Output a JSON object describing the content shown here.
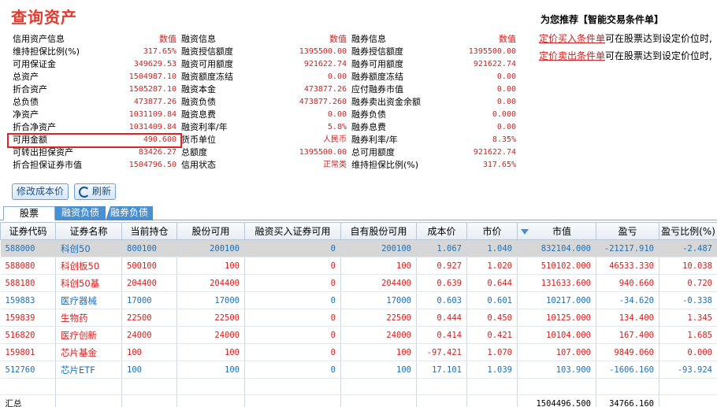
{
  "title": "查询资产",
  "info": {
    "rows": [
      [
        {
          "label": "信用资产信息",
          "value": "数值",
          "hdr": true
        },
        {
          "label": "融资信息",
          "value": "数值",
          "hdr": true
        },
        {
          "label": "融券信息",
          "value": "数值",
          "hdr": true
        }
      ],
      [
        {
          "label": "维持担保比例(%)",
          "value": "317.65%"
        },
        {
          "label": "融资授信额度",
          "value": "1395500.00"
        },
        {
          "label": "融券授信额度",
          "value": "1395500.00"
        }
      ],
      [
        {
          "label": "可用保证金",
          "value": "349629.53"
        },
        {
          "label": "融资可用额度",
          "value": "921622.74"
        },
        {
          "label": "融券可用额度",
          "value": "921622.74"
        }
      ],
      [
        {
          "label": "总资产",
          "value": "1504987.10"
        },
        {
          "label": "融资额度冻结",
          "value": "0.00"
        },
        {
          "label": "融券额度冻结",
          "value": "0.00"
        }
      ],
      [
        {
          "label": "折合资产",
          "value": "1505287.10"
        },
        {
          "label": "融资本金",
          "value": "473877.26"
        },
        {
          "label": "应付融券市值",
          "value": "0.00"
        }
      ],
      [
        {
          "label": "总负债",
          "value": "473877.26"
        },
        {
          "label": "融资负债",
          "value": "473877.260"
        },
        {
          "label": "融券卖出资金余额",
          "value": "0.00"
        }
      ],
      [
        {
          "label": "净资产",
          "value": "1031109.84"
        },
        {
          "label": "融资息费",
          "value": "0.00"
        },
        {
          "label": "融券负债",
          "value": "0.000"
        }
      ],
      [
        {
          "label": "折合净资产",
          "value": "1031409.84"
        },
        {
          "label": "融资利率/年",
          "value": "5.8%"
        },
        {
          "label": "融券息费",
          "value": "0.00"
        }
      ],
      [
        {
          "label": "可用金额",
          "value": "490.600"
        },
        {
          "label": "货币单位",
          "value": "人民币",
          "cjk": true
        },
        {
          "label": "融券利率/年",
          "value": "8.35%"
        }
      ],
      [
        {
          "label": "可转出担保资产",
          "value": "83426.27"
        },
        {
          "label": "总额度",
          "value": "1395500.00"
        },
        {
          "label": "总可用额度",
          "value": "921622.74"
        }
      ],
      [
        {
          "label": "折合担保证券市值",
          "value": "1504796.50"
        },
        {
          "label": "信用状态",
          "value": "正常类",
          "cjk": true
        },
        {
          "label": "维持担保比例(%)",
          "value": "317.65%"
        }
      ]
    ]
  },
  "recommend": {
    "title": "为您推荐【智能交易条件单】",
    "buy_link": "定价买入条件单",
    "buy_text": "可在股票达到设定价位时,",
    "sell_link": "定价卖出条件单",
    "sell_text": "可在股票达到设定价位时,"
  },
  "buttons": {
    "modify_cost": "修改成本价",
    "refresh": "刷新"
  },
  "tabs": [
    "股票",
    "融资负债",
    "融券负债"
  ],
  "table": {
    "columns": [
      "证券代码",
      "证券名称",
      "当前持仓",
      "股份可用",
      "融资买入证券可用",
      "自有股份可用",
      "成本价",
      "市价",
      "市值",
      "盈亏",
      "盈亏比例(%)"
    ],
    "rows": [
      {
        "code": "588000",
        "name": "科创50",
        "hold": "800100",
        "avail": "200100",
        "margin": "0",
        "own": "200100",
        "cost": "1.067",
        "price": "1.040",
        "mv": "832104.000",
        "pl": "-21217.910",
        "pct": "-2.487",
        "style": "sel"
      },
      {
        "code": "588080",
        "name": "科创板50",
        "hold": "500100",
        "avail": "100",
        "margin": "0",
        "own": "100",
        "cost": "0.927",
        "price": "1.020",
        "mv": "510102.000",
        "pl": "46533.330",
        "pct": "10.038",
        "style": "up"
      },
      {
        "code": "588180",
        "name": "科创50基",
        "hold": "204400",
        "avail": "204400",
        "margin": "0",
        "own": "204400",
        "cost": "0.639",
        "price": "0.644",
        "mv": "131633.600",
        "pl": "940.660",
        "pct": "0.720",
        "style": "up"
      },
      {
        "code": "159883",
        "name": "医疗器械",
        "hold": "17000",
        "avail": "17000",
        "margin": "0",
        "own": "17000",
        "cost": "0.603",
        "price": "0.601",
        "mv": "10217.000",
        "pl": "-34.620",
        "pct": "-0.338",
        "style": "down"
      },
      {
        "code": "159839",
        "name": "生物药",
        "hold": "22500",
        "avail": "22500",
        "margin": "0",
        "own": "22500",
        "cost": "0.444",
        "price": "0.450",
        "mv": "10125.000",
        "pl": "134.400",
        "pct": "1.345",
        "style": "up"
      },
      {
        "code": "516820",
        "name": "医疗创新",
        "hold": "24000",
        "avail": "24000",
        "margin": "0",
        "own": "24000",
        "cost": "0.414",
        "price": "0.421",
        "mv": "10104.000",
        "pl": "167.400",
        "pct": "1.685",
        "style": "up"
      },
      {
        "code": "159801",
        "name": "芯片基金",
        "hold": "100",
        "avail": "100",
        "margin": "0",
        "own": "100",
        "cost": "-97.421",
        "price": "1.070",
        "mv": "107.000",
        "pl": "9849.060",
        "pct": "0.000",
        "style": "up"
      },
      {
        "code": "512760",
        "name": "芯片ETF",
        "hold": "100",
        "avail": "100",
        "margin": "0",
        "own": "100",
        "cost": "17.101",
        "price": "1.039",
        "mv": "103.900",
        "pl": "-1606.160",
        "pct": "-93.924",
        "style": "down"
      }
    ],
    "summary": {
      "label": "汇总",
      "mv": "1504496.500",
      "pl": "34766.160"
    }
  }
}
